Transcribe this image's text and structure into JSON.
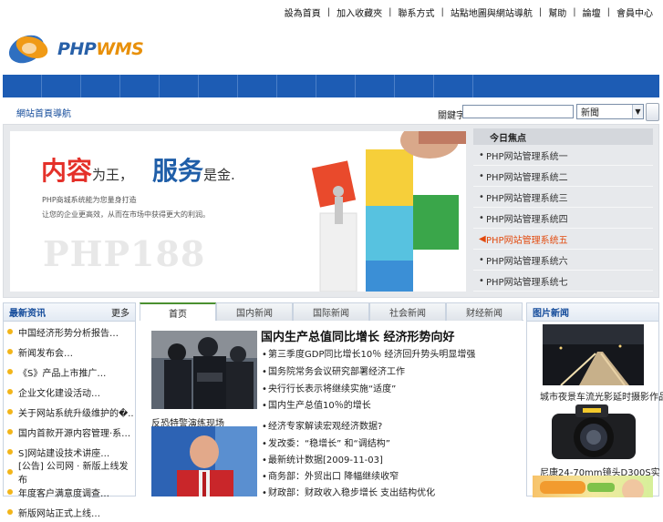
{
  "top_links": [
    "設為首頁",
    "加入收藏夾",
    "聯系方式",
    "站點地圖與網站導航",
    "幫助",
    "論壇",
    "會員中心"
  ],
  "logo": {
    "text_php": "PHP",
    "text_wms": "WMS"
  },
  "nav_cells": 12,
  "breadcrumb": "網站首頁導航",
  "search": {
    "label": "關鍵字:",
    "value": "",
    "select_value": "新聞"
  },
  "banner": {
    "title_red": "内容",
    "title_red_suffix": "为王，",
    "title_blue": "服务",
    "title_blue_suffix": "是金.",
    "sub1": "PHP商城系统能为您量身打造",
    "sub2": "让您的企业更高效，从而在市场中获得更大的利润。",
    "watermark": "PHP188"
  },
  "focus": {
    "title": "今日焦点",
    "items": [
      {
        "label": "PHP网站管理系统一",
        "active": false
      },
      {
        "label": "PHP网站管理系统二",
        "active": false
      },
      {
        "label": "PHP网站管理系统三",
        "active": false
      },
      {
        "label": "PHP网站管理系统四",
        "active": false
      },
      {
        "label": "PHP网站管理系统五",
        "active": true
      },
      {
        "label": "PHP网站管理系统六",
        "active": false
      },
      {
        "label": "PHP网站管理系统七",
        "active": false
      }
    ]
  },
  "left_box": {
    "title": "最新资讯",
    "more": "更多",
    "items": [
      "中国经济形势分析报告…",
      "新闻发布会…",
      "《S》产品上市推广…",
      "企业文化建设活动…",
      "关于网站系统升级维护的�..",
      "国内首款开源内容管理·系…",
      "S]网站建设技术讲座…",
      "[公告] 公司网 · 新版上线发布",
      "年度客户满意度调查…",
      "新版网站正式上线…"
    ]
  },
  "tabs": [
    {
      "label": "首页",
      "active": true
    },
    {
      "label": "国内新闻",
      "active": false
    },
    {
      "label": "国际新闻",
      "active": false
    },
    {
      "label": "社会新闻",
      "active": false
    },
    {
      "label": "财经新闻",
      "active": false
    }
  ],
  "photo1_caption": "反恐特警演练现场",
  "headline": "国内生产总值同比增长 经济形势向好",
  "news_items": [
    "第三季度GDP同比增长10％ 经济回升势头明显增强",
    "国务院常务会议研究部署经济工作",
    "央行行长表示将继续实施“适度”",
    "国内生产总值10％的增长",
    "经济专家解读宏观经济数据?",
    "发改委：“稳增长” 和“调结构”",
    "最新统计数据[2009-11-03]",
    "商务部：外贸出口 降幅继续收窄",
    "财政部：财政收入稳步增长 支出结构优化"
  ],
  "right_box": {
    "title": "图片新闻",
    "cap1": "城市夜景车流光影延时摄影作品",
    "cap2": "尼康24-70mm镜头D300S实"
  }
}
